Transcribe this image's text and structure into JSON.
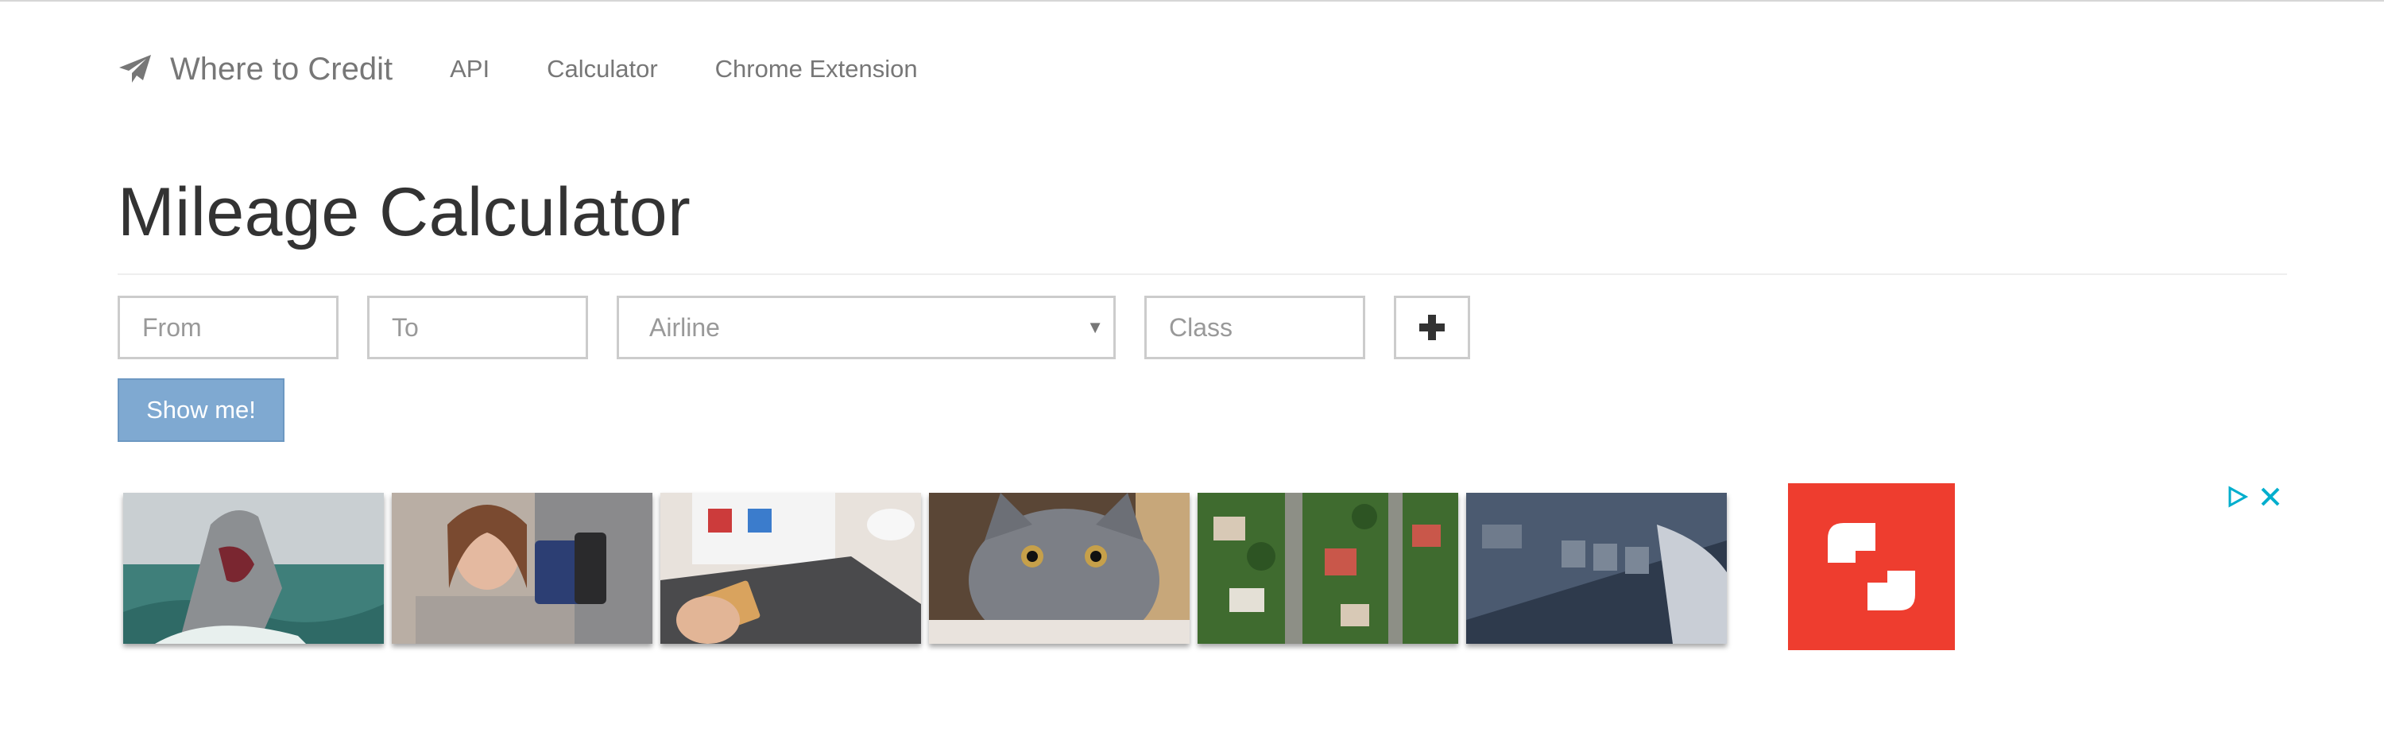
{
  "navbar": {
    "brand": "Where to Credit",
    "links": [
      "API",
      "Calculator",
      "Chrome Extension"
    ]
  },
  "page": {
    "title": "Mileage Calculator"
  },
  "form": {
    "from_placeholder": "From",
    "to_placeholder": "To",
    "airline_selected": "Airline",
    "class_placeholder": "Class",
    "submit_label": "Show me!"
  },
  "ads": {
    "thumbnails": [
      "shark-photo",
      "woman-with-phone-and-card-photo",
      "card-payment-laptop-photo",
      "gray-cat-photo",
      "aerial-suburb-photo",
      "credit-card-closeup-photo"
    ],
    "logo_color": "#ee3d2f",
    "accent": "#00aecd"
  },
  "colors": {
    "primary_button": "#7fa9d1",
    "nav_text": "#777777"
  }
}
